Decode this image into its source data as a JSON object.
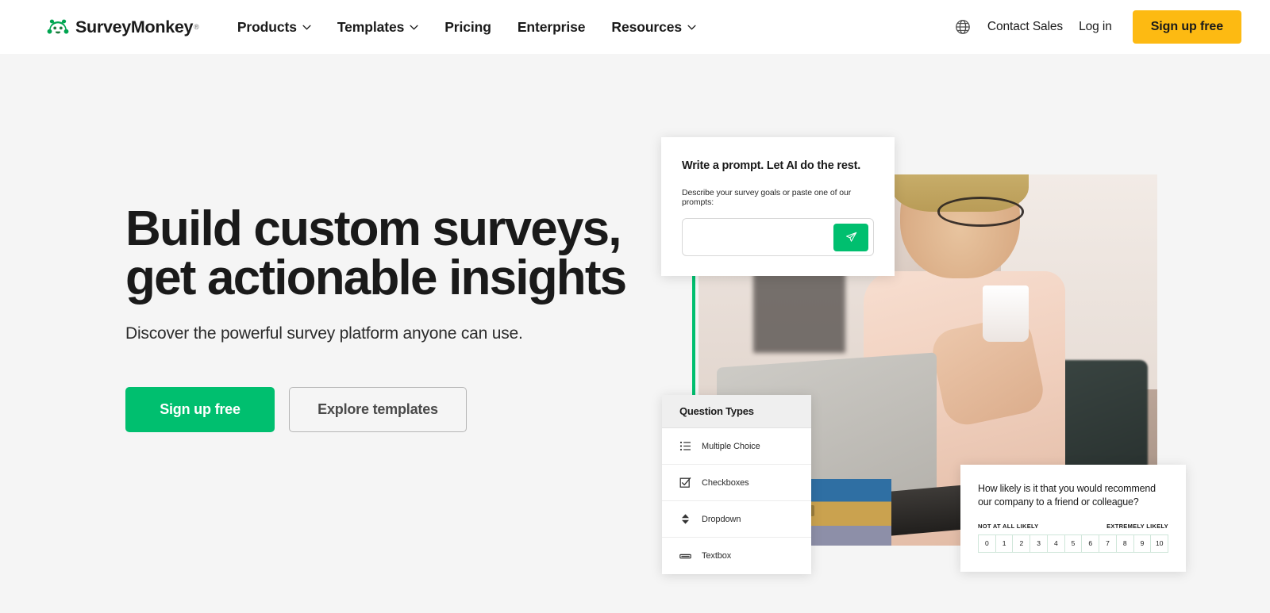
{
  "brand": {
    "name": "SurveyMonkey",
    "trademark": "®",
    "logo_icon": "monkey-logo-icon",
    "green": "#00BF6F",
    "yellow": "#FDBA12"
  },
  "nav": {
    "links": [
      {
        "label": "Products",
        "has_dropdown": true
      },
      {
        "label": "Templates",
        "has_dropdown": true
      },
      {
        "label": "Pricing",
        "has_dropdown": false
      },
      {
        "label": "Enterprise",
        "has_dropdown": false
      },
      {
        "label": "Resources",
        "has_dropdown": true
      }
    ],
    "language_icon": "globe-icon",
    "contact_sales": "Contact Sales",
    "log_in": "Log in",
    "sign_up": "Sign up free"
  },
  "hero": {
    "title_line1": "Build custom surveys,",
    "title_line2": "get actionable insights",
    "subtitle": "Discover the powerful survey platform anyone can use.",
    "primary_cta": "Sign up free",
    "secondary_cta": "Explore templates"
  },
  "ai_card": {
    "title": "Write a prompt. Let AI do the rest.",
    "subtitle": "Describe your survey goals or paste one of our prompts:",
    "input_value": "",
    "input_placeholder": "",
    "send_icon": "paper-plane-icon"
  },
  "question_types_card": {
    "header": "Question Types",
    "items": [
      {
        "label": "Multiple Choice",
        "icon": "bulleted-list-icon"
      },
      {
        "label": "Checkboxes",
        "icon": "checkbox-icon"
      },
      {
        "label": "Dropdown",
        "icon": "dropdown-arrows-icon"
      },
      {
        "label": "Textbox",
        "icon": "textbox-icon"
      }
    ]
  },
  "nps_card": {
    "question_line1": "How likely is it that you would recommend",
    "question_line2": "our company to a friend or colleague?",
    "low_label": "NOT AT ALL LIKELY",
    "high_label": "EXTREMELY LIKELY",
    "scale": [
      "0",
      "1",
      "2",
      "3",
      "4",
      "5",
      "6",
      "7",
      "8",
      "9",
      "10"
    ]
  }
}
